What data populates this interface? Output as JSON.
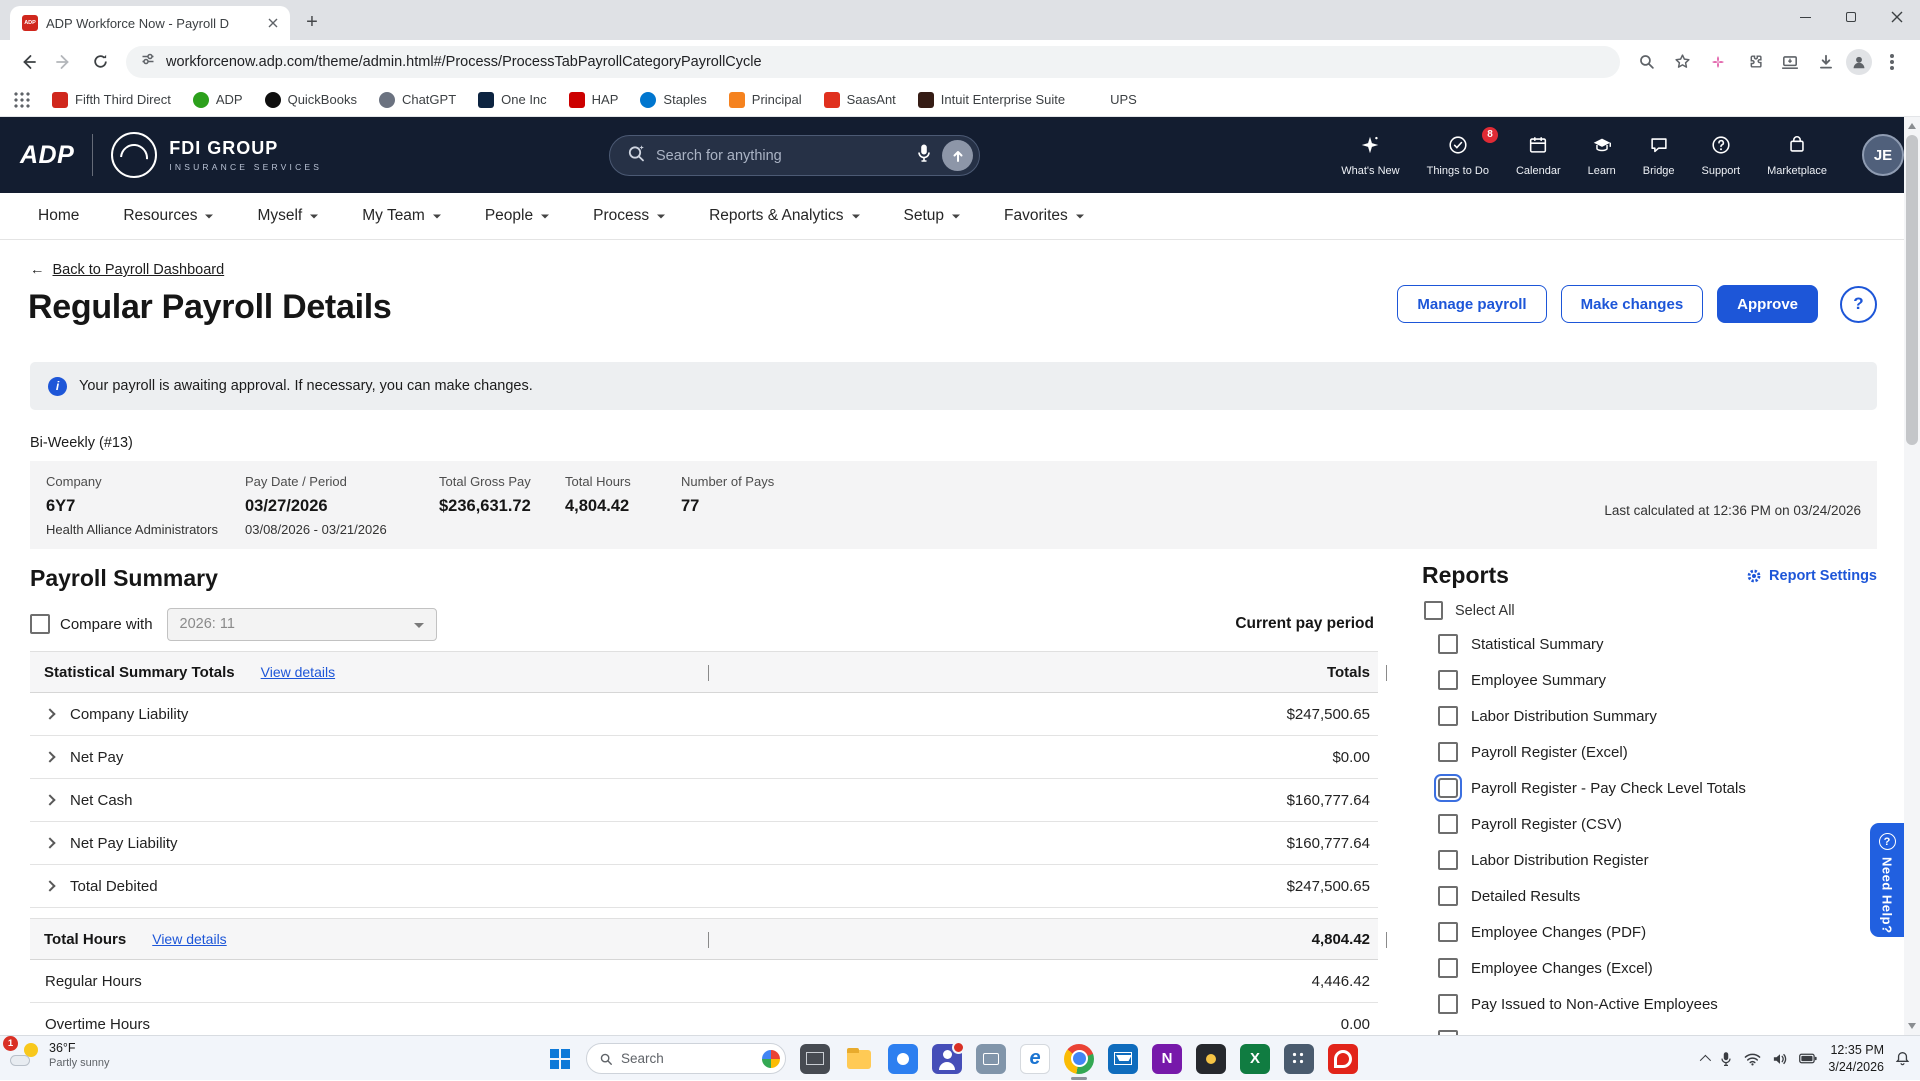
{
  "palette": {
    "header_bg": "#131d30",
    "accent_blue": "#1d56d8",
    "banner_bg": "#edeff1",
    "section_bg": "#f4f4f5",
    "need_help_bg": "#2160e0",
    "badge_red": "#e02b35",
    "adp_logo_red": "#d0271d"
  },
  "icons": {
    "back_arrow": "←",
    "help": "?",
    "info": "i",
    "new_tab": "+",
    "close": "×"
  },
  "browser": {
    "tab_title": "ADP Workforce Now - Payroll D",
    "tab_favicon": "ADP",
    "url": "workforcenow.adp.com/theme/admin.html#/Process/ProcessTabPayrollCategoryPayrollCycle",
    "bookmarks": [
      {
        "label": "Fifth Third Direct"
      },
      {
        "label": "ADP"
      },
      {
        "label": "QuickBooks"
      },
      {
        "label": "ChatGPT"
      },
      {
        "label": "One Inc"
      },
      {
        "label": "HAP"
      },
      {
        "label": "Staples"
      },
      {
        "label": "Principal"
      },
      {
        "label": "SaasAnt"
      },
      {
        "label": "Intuit Enterprise Suite"
      },
      {
        "label": "UPS"
      }
    ]
  },
  "header": {
    "adp_logo": "ADP",
    "brand": "FDI GROUP",
    "brand_sub": "INSURANCE SERVICES",
    "search_placeholder": "Search for anything",
    "menu": [
      {
        "label": "What's New"
      },
      {
        "label": "Things to Do",
        "badge": "8"
      },
      {
        "label": "Calendar"
      },
      {
        "label": "Learn"
      },
      {
        "label": "Bridge"
      },
      {
        "label": "Support"
      },
      {
        "label": "Marketplace"
      }
    ],
    "avatar_initials": "JE"
  },
  "nav": [
    {
      "label": "Home"
    },
    {
      "label": "Resources"
    },
    {
      "label": "Myself"
    },
    {
      "label": "My Team"
    },
    {
      "label": "People"
    },
    {
      "label": "Process"
    },
    {
      "label": "Reports & Analytics"
    },
    {
      "label": "Setup"
    },
    {
      "label": "Favorites"
    }
  ],
  "page": {
    "back_link": "Back to Payroll Dashboard",
    "title": "Regular Payroll Details",
    "buttons": {
      "manage": "Manage payroll",
      "changes": "Make changes",
      "approve": "Approve"
    },
    "banner_text": "Your payroll is awaiting approval. If necessary, you can make changes.",
    "cycle_label": "Bi-Weekly (#13)",
    "facts": {
      "company_label": "Company",
      "company_value": "6Y7",
      "company_sub": "Health Alliance Administrators",
      "paydate_label": "Pay Date / Period",
      "paydate_value": "03/27/2026",
      "paydate_sub": "03/08/2026 - 03/21/2026",
      "gross_label": "Total Gross Pay",
      "gross_value": "$236,631.72",
      "hours_label": "Total Hours",
      "hours_value": "4,804.42",
      "pays_label": "Number of Pays",
      "pays_value": "77",
      "last_calculated": "Last calculated at 12:36 PM on 03/24/2026"
    }
  },
  "summary": {
    "title": "Payroll Summary",
    "compare_label": "Compare with",
    "compare_value": "2026: 11",
    "current_period_label": "Current pay period",
    "stat_header": "Statistical Summary Totals",
    "view_details": "View details",
    "totals_label": "Totals",
    "rows": [
      {
        "label": "Company Liability",
        "amount": "$247,500.65"
      },
      {
        "label": "Net Pay",
        "amount": "$0.00"
      },
      {
        "label": "Net Cash",
        "amount": "$160,777.64"
      },
      {
        "label": "Net Pay Liability",
        "amount": "$160,777.64"
      },
      {
        "label": "Total Debited",
        "amount": "$247,500.65"
      }
    ],
    "hours_header": "Total Hours",
    "hours_total": "4,804.42",
    "hours_rows": [
      {
        "label": "Regular Hours",
        "amount": "4,446.42"
      },
      {
        "label": "Overtime Hours",
        "amount": "0.00"
      }
    ]
  },
  "reports": {
    "title": "Reports",
    "settings_label": "Report Settings",
    "select_all": "Select All",
    "focused_index": 4,
    "items": [
      "Statistical Summary",
      "Employee Summary",
      "Labor Distribution Summary",
      "Payroll Register (Excel)",
      "Payroll Register - Pay Check Level Totals",
      "Payroll Register (CSV)",
      "Labor Distribution Register",
      "Detailed Results",
      "Employee Changes (PDF)",
      "Employee Changes (Excel)",
      "Pay Issued to Non-Active Employees"
    ]
  },
  "need_help_label": "Need Help?",
  "taskbar": {
    "weather_badge": "1",
    "weather_temp": "36°F",
    "weather_desc": "Partly sunny",
    "search_placeholder": "Search",
    "time": "12:35 PM",
    "date": "3/24/2026"
  }
}
